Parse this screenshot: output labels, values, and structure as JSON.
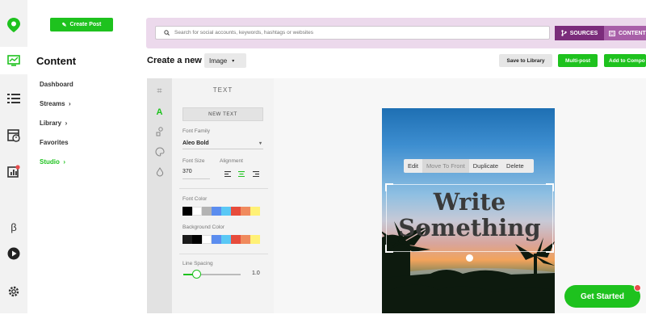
{
  "rail": {
    "icons": [
      "location-pin-logo-icon",
      "publisher-icon",
      "streams-list-icon",
      "planner-icon",
      "analytics-icon",
      "beta-icon",
      "play-icon",
      "settings-gear-icon"
    ],
    "beta_label": "β"
  },
  "sidebar": {
    "create_post_label": "Create Post",
    "title": "Content",
    "items": [
      {
        "label": "Dashboard"
      },
      {
        "label": "Streams",
        "chevron": "›"
      },
      {
        "label": "Library",
        "chevron": "›"
      },
      {
        "label": "Favorites"
      },
      {
        "label": "Studio",
        "chevron": "›",
        "active": true
      }
    ]
  },
  "search": {
    "placeholder": "Search for social accounts, keywords, hashtags or websites",
    "sources_label": "SOURCES",
    "content_label": "CONTENT"
  },
  "toolbar": {
    "create_new_label": "Create a new",
    "type_value": "Image",
    "save_to_library_label": "Save to Library",
    "multi_post_label": "Multi-post",
    "add_to_compose_label": "Add to Compo"
  },
  "text_panel": {
    "heading": "TEXT",
    "new_text_label": "NEW TEXT",
    "font_family_label": "Font Family",
    "font_family_value": "Aleo Bold",
    "font_size_label": "Font Size",
    "font_size_value": "370",
    "alignment_label": "Alignment",
    "font_color_label": "Font Color",
    "font_colors": [
      "#000000",
      "#ffffff",
      "#b3b3b3",
      "#5b8def",
      "#5ac8f5",
      "#e74c3c",
      "#f08a5d",
      "#fff176"
    ],
    "background_color_label": "Background Color",
    "background_colors": [
      "#1a1a1a",
      "#000000",
      "#ffffff",
      "#5b8def",
      "#5ac8f5",
      "#e74c3c",
      "#f08a5d",
      "#fff176"
    ],
    "line_spacing_label": "Line Spacing",
    "line_spacing_value": "1.0"
  },
  "canvas": {
    "context_menu": [
      "Edit",
      "Move To Front",
      "Duplicate",
      "Delete"
    ],
    "text_line1": "Write",
    "text_line2": "Something"
  },
  "cta": {
    "get_started_label": "Get Started"
  },
  "colors": {
    "brand_green": "#1ec21e",
    "sources_purple": "#7b2c7b",
    "topbar_bg": "#ecd9ec"
  }
}
